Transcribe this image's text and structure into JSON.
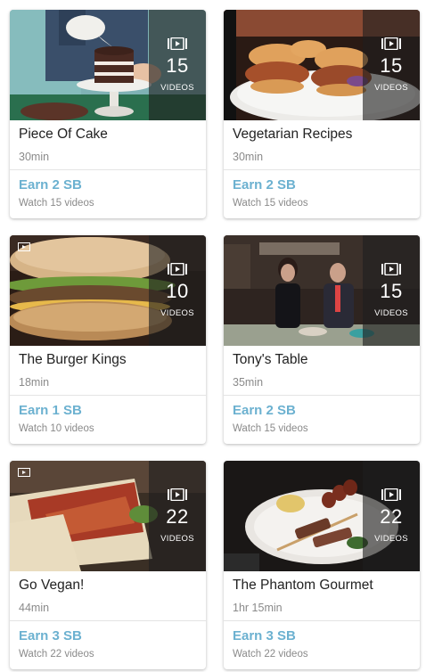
{
  "overlay_label": "VIDEOS",
  "colors": {
    "earn": "#6cb1d0",
    "muted": "#8a8a8a",
    "title": "#222222"
  },
  "icons": {
    "playlist": "playlist-play-icon",
    "corner": "queue-icon"
  },
  "cards": [
    {
      "title": "Piece Of Cake",
      "duration": "30min",
      "count": "15",
      "earn": "Earn 2 SB",
      "watch": "Watch 15 videos"
    },
    {
      "title": "Vegetarian Recipes",
      "duration": "30min",
      "count": "15",
      "earn": "Earn 2 SB",
      "watch": "Watch 15 videos"
    },
    {
      "title": "The Burger Kings",
      "duration": "18min",
      "count": "10",
      "earn": "Earn 1 SB",
      "watch": "Watch 10 videos"
    },
    {
      "title": "Tony's Table",
      "duration": "35min",
      "count": "15",
      "earn": "Earn 2 SB",
      "watch": "Watch 15 videos"
    },
    {
      "title": "Go Vegan!",
      "duration": "44min",
      "count": "22",
      "earn": "Earn 3 SB",
      "watch": "Watch 22 videos"
    },
    {
      "title": "The Phantom Gourmet",
      "duration": "1hr 15min",
      "count": "22",
      "earn": "Earn 3 SB",
      "watch": "Watch 22 videos"
    }
  ]
}
